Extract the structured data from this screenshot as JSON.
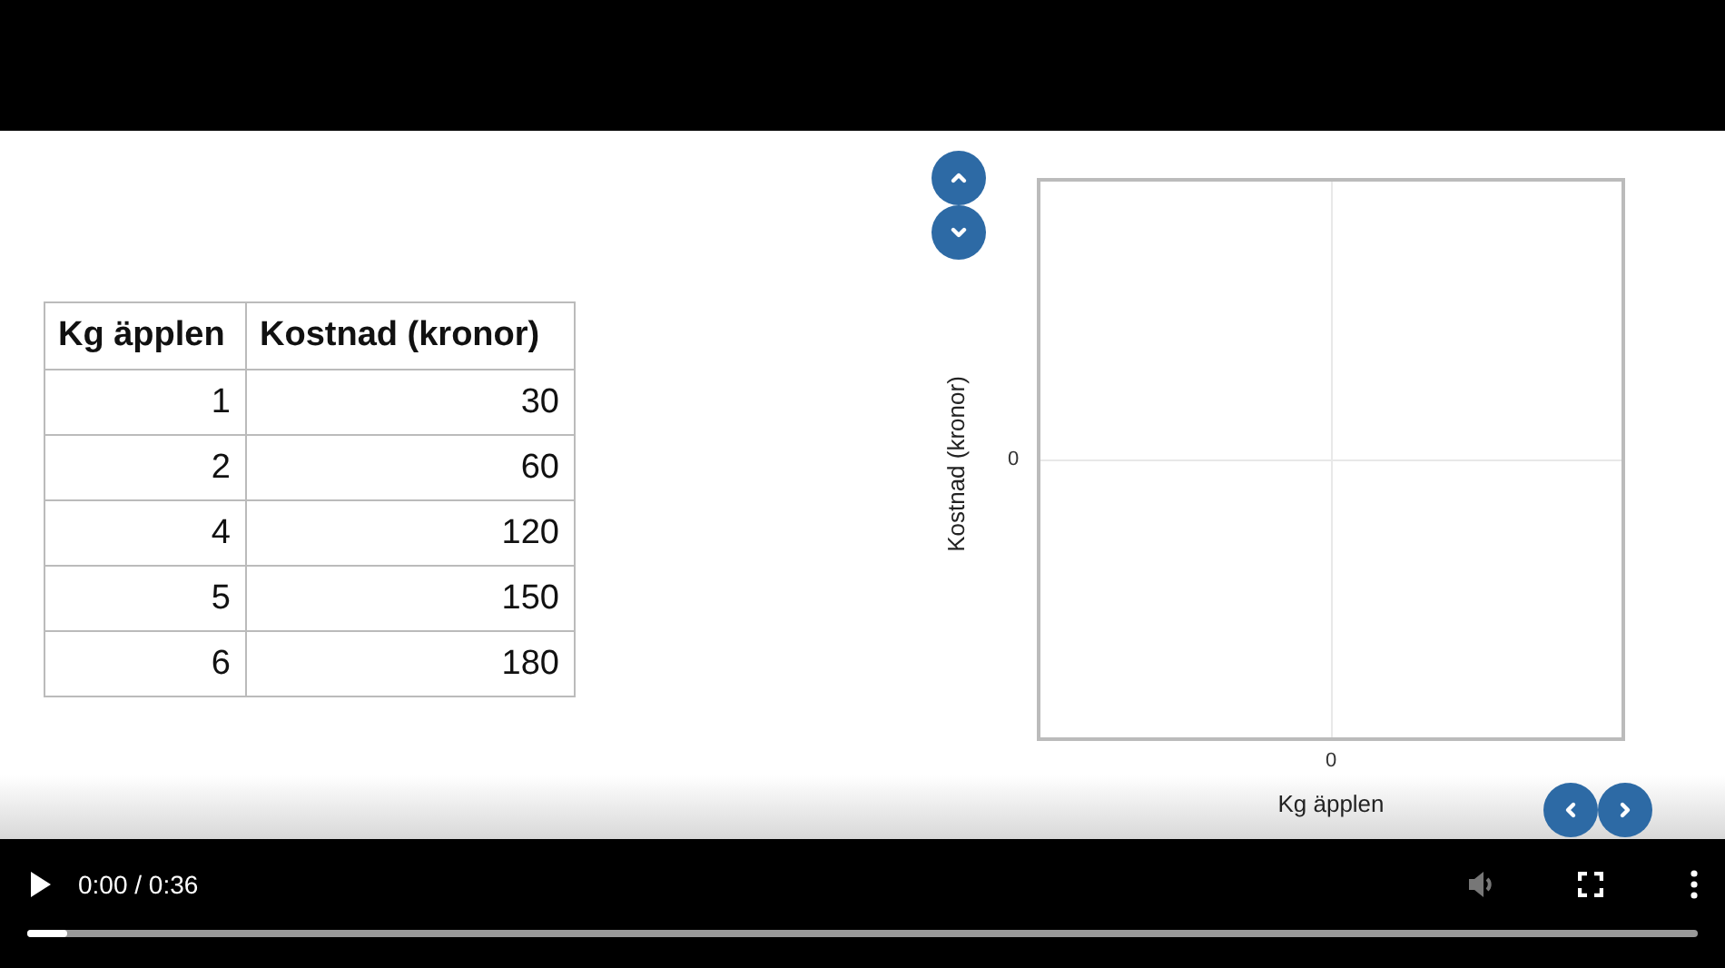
{
  "table": {
    "columns": [
      "Kg äpplen",
      "Kostnad (kronor)"
    ],
    "rows": [
      [
        "1",
        "30"
      ],
      [
        "2",
        "60"
      ],
      [
        "4",
        "120"
      ],
      [
        "5",
        "150"
      ],
      [
        "6",
        "180"
      ]
    ]
  },
  "graph": {
    "ylabel": "Kostnad (kronor)",
    "xlabel": "Kg äpplen",
    "ytick": "0",
    "xtick": "0"
  },
  "player": {
    "time": "0:00 / 0:36",
    "progress": {
      "level": 0.024
    }
  }
}
